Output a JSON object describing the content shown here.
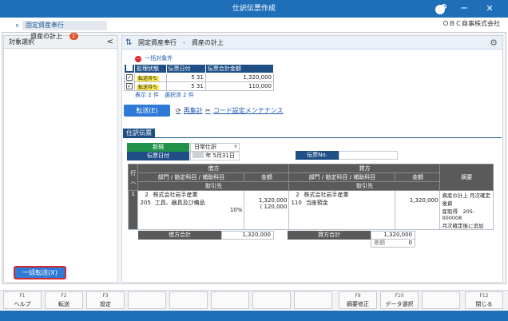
{
  "window": {
    "title": "仕訳伝票作成",
    "company": "ＯＢＣ商事株式会社",
    "minimize": "─",
    "close": "✕"
  },
  "left_pane": {
    "header": "対象選択",
    "collapse": "<",
    "tree": {
      "root": "固定資産奉行",
      "child": "資産の計上",
      "child_badge": "2"
    },
    "bulk_transfer": "一括転送(X)"
  },
  "main_header": {
    "text": "固定資産奉行　-　資産の計上"
  },
  "slip_list": {
    "exclude_link": "一括対象外",
    "columns": [
      "処理状態",
      "伝票日付",
      "伝票合計金額"
    ],
    "rows": [
      {
        "checked": "✓",
        "status": "転送待ち",
        "month": "5",
        "day": "31",
        "amount": "1,320,000"
      },
      {
        "checked": "✓",
        "status": "転送待ち",
        "month": "5",
        "day": "31",
        "amount": "110,000"
      }
    ],
    "summary": "表示 2 件　選択済 2 件"
  },
  "actions": {
    "transfer": "転送(E)",
    "recalc": "再集計",
    "code_settings": "コード設定メンテナンス"
  },
  "journal": {
    "tab": "仕訳伝票",
    "kind_label": "新規",
    "kind_value": "日常仕訳",
    "date_label": "伝票日付",
    "date_era": "年",
    "date_value": "5月31日",
    "slip_no_label": "伝票No.",
    "grid_headers": {
      "line": "行",
      "debit": "借方",
      "credit": "貸方",
      "accounts": "部門 / 勘定科目 / 補助科目",
      "amount": "金額",
      "partner": "取引先",
      "memo": "摘要"
    },
    "entry": {
      "line_no": "1",
      "debit_dept": "2",
      "debit_dept_name": "株式会社岩手産業",
      "debit_code": "205",
      "debit_account": "工具、器具及び備品",
      "debit_rate": "10%",
      "debit_amount": "1,320,000",
      "debit_tax": "( 120,000",
      "credit_dept": "2",
      "credit_dept_name": "株式会社岩手産業",
      "credit_code": "110",
      "credit_account": "当座預金",
      "credit_amount": "1,320,000",
      "memo_line1": "資産の計上 月次確定後資",
      "memo_line2": "産取得　205-000008",
      "memo_line3": "月次確定後に追加"
    },
    "totals": {
      "debit_label": "借方合計",
      "debit_value": "1,320,000",
      "credit_label": "貸方合計",
      "credit_value": "1,320,000",
      "diff_label": "差額",
      "diff_value": "0"
    }
  },
  "function_keys": [
    {
      "key": "F1",
      "label": "ヘルプ"
    },
    {
      "key": "F2",
      "label": "転送"
    },
    {
      "key": "F3",
      "label": "設定"
    },
    {
      "key": "",
      "label": ""
    },
    {
      "key": "",
      "label": ""
    },
    {
      "key": "",
      "label": ""
    },
    {
      "key": "",
      "label": ""
    },
    {
      "key": "",
      "label": ""
    },
    {
      "key": "F9",
      "label": "摘要修正"
    },
    {
      "key": "F10",
      "label": "データ選択"
    },
    {
      "key": "",
      "label": ""
    },
    {
      "key": "F12",
      "label": "閉じる"
    }
  ],
  "colors": {
    "titlebar": "#1f6fb8",
    "navy": "#1f4f86",
    "green": "#22924a",
    "yellow": "#fde94f",
    "red": "#d7262e"
  }
}
